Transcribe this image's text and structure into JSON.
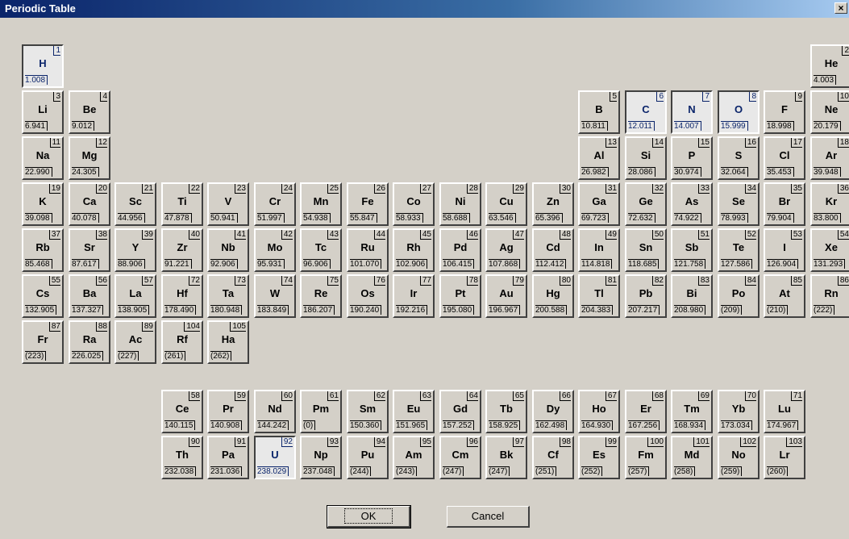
{
  "window": {
    "title": "Periodic Table",
    "close_label": "×"
  },
  "selected_color": "#0a246a",
  "elements": [
    {
      "n": "1",
      "s": "H",
      "m": "1.008",
      "c": 0,
      "r": 0,
      "sel": true
    },
    {
      "n": "2",
      "s": "He",
      "m": "4.003",
      "c": 17,
      "r": 0
    },
    {
      "n": "3",
      "s": "Li",
      "m": "6.941",
      "c": 0,
      "r": 1
    },
    {
      "n": "4",
      "s": "Be",
      "m": "9.012",
      "c": 1,
      "r": 1
    },
    {
      "n": "5",
      "s": "B",
      "m": "10.811",
      "c": 12,
      "r": 1
    },
    {
      "n": "6",
      "s": "C",
      "m": "12.011",
      "c": 13,
      "r": 1,
      "sel": true
    },
    {
      "n": "7",
      "s": "N",
      "m": "14.007",
      "c": 14,
      "r": 1,
      "sel": true
    },
    {
      "n": "8",
      "s": "O",
      "m": "15.999",
      "c": 15,
      "r": 1,
      "sel": true
    },
    {
      "n": "9",
      "s": "F",
      "m": "18.998",
      "c": 16,
      "r": 1
    },
    {
      "n": "10",
      "s": "Ne",
      "m": "20.179",
      "c": 17,
      "r": 1
    },
    {
      "n": "11",
      "s": "Na",
      "m": "22.990",
      "c": 0,
      "r": 2
    },
    {
      "n": "12",
      "s": "Mg",
      "m": "24.305",
      "c": 1,
      "r": 2
    },
    {
      "n": "13",
      "s": "Al",
      "m": "26.982",
      "c": 12,
      "r": 2
    },
    {
      "n": "14",
      "s": "Si",
      "m": "28.086",
      "c": 13,
      "r": 2
    },
    {
      "n": "15",
      "s": "P",
      "m": "30.974",
      "c": 14,
      "r": 2
    },
    {
      "n": "16",
      "s": "S",
      "m": "32.064",
      "c": 15,
      "r": 2
    },
    {
      "n": "17",
      "s": "Cl",
      "m": "35.453",
      "c": 16,
      "r": 2
    },
    {
      "n": "18",
      "s": "Ar",
      "m": "39.948",
      "c": 17,
      "r": 2
    },
    {
      "n": "19",
      "s": "K",
      "m": "39.098",
      "c": 0,
      "r": 3
    },
    {
      "n": "20",
      "s": "Ca",
      "m": "40.078",
      "c": 1,
      "r": 3
    },
    {
      "n": "21",
      "s": "Sc",
      "m": "44.956",
      "c": 2,
      "r": 3
    },
    {
      "n": "22",
      "s": "Ti",
      "m": "47.878",
      "c": 3,
      "r": 3
    },
    {
      "n": "23",
      "s": "V",
      "m": "50.941",
      "c": 4,
      "r": 3
    },
    {
      "n": "24",
      "s": "Cr",
      "m": "51.997",
      "c": 5,
      "r": 3
    },
    {
      "n": "25",
      "s": "Mn",
      "m": "54.938",
      "c": 6,
      "r": 3
    },
    {
      "n": "26",
      "s": "Fe",
      "m": "55.847",
      "c": 7,
      "r": 3
    },
    {
      "n": "27",
      "s": "Co",
      "m": "58.933",
      "c": 8,
      "r": 3
    },
    {
      "n": "28",
      "s": "Ni",
      "m": "58.688",
      "c": 9,
      "r": 3
    },
    {
      "n": "29",
      "s": "Cu",
      "m": "63.546",
      "c": 10,
      "r": 3
    },
    {
      "n": "30",
      "s": "Zn",
      "m": "65.396",
      "c": 11,
      "r": 3
    },
    {
      "n": "31",
      "s": "Ga",
      "m": "69.723",
      "c": 12,
      "r": 3
    },
    {
      "n": "32",
      "s": "Ge",
      "m": "72.632",
      "c": 13,
      "r": 3
    },
    {
      "n": "33",
      "s": "As",
      "m": "74.922",
      "c": 14,
      "r": 3
    },
    {
      "n": "34",
      "s": "Se",
      "m": "78.993",
      "c": 15,
      "r": 3
    },
    {
      "n": "35",
      "s": "Br",
      "m": "79.904",
      "c": 16,
      "r": 3
    },
    {
      "n": "36",
      "s": "Kr",
      "m": "83.800",
      "c": 17,
      "r": 3
    },
    {
      "n": "37",
      "s": "Rb",
      "m": "85.468",
      "c": 0,
      "r": 4
    },
    {
      "n": "38",
      "s": "Sr",
      "m": "87.617",
      "c": 1,
      "r": 4
    },
    {
      "n": "39",
      "s": "Y",
      "m": "88.906",
      "c": 2,
      "r": 4
    },
    {
      "n": "40",
      "s": "Zr",
      "m": "91.221",
      "c": 3,
      "r": 4
    },
    {
      "n": "41",
      "s": "Nb",
      "m": "92.906",
      "c": 4,
      "r": 4
    },
    {
      "n": "42",
      "s": "Mo",
      "m": "95.931",
      "c": 5,
      "r": 4
    },
    {
      "n": "43",
      "s": "Tc",
      "m": "96.906",
      "c": 6,
      "r": 4
    },
    {
      "n": "44",
      "s": "Ru",
      "m": "101.070",
      "c": 7,
      "r": 4
    },
    {
      "n": "45",
      "s": "Rh",
      "m": "102.906",
      "c": 8,
      "r": 4
    },
    {
      "n": "46",
      "s": "Pd",
      "m": "106.415",
      "c": 9,
      "r": 4
    },
    {
      "n": "47",
      "s": "Ag",
      "m": "107.868",
      "c": 10,
      "r": 4
    },
    {
      "n": "48",
      "s": "Cd",
      "m": "112.412",
      "c": 11,
      "r": 4
    },
    {
      "n": "49",
      "s": "In",
      "m": "114.818",
      "c": 12,
      "r": 4
    },
    {
      "n": "50",
      "s": "Sn",
      "m": "118.685",
      "c": 13,
      "r": 4
    },
    {
      "n": "51",
      "s": "Sb",
      "m": "121.758",
      "c": 14,
      "r": 4
    },
    {
      "n": "52",
      "s": "Te",
      "m": "127.586",
      "c": 15,
      "r": 4
    },
    {
      "n": "53",
      "s": "I",
      "m": "126.904",
      "c": 16,
      "r": 4
    },
    {
      "n": "54",
      "s": "Xe",
      "m": "131.293",
      "c": 17,
      "r": 4
    },
    {
      "n": "55",
      "s": "Cs",
      "m": "132.905",
      "c": 0,
      "r": 5
    },
    {
      "n": "56",
      "s": "Ba",
      "m": "137.327",
      "c": 1,
      "r": 5
    },
    {
      "n": "57",
      "s": "La",
      "m": "138.905",
      "c": 2,
      "r": 5
    },
    {
      "n": "72",
      "s": "Hf",
      "m": "178.490",
      "c": 3,
      "r": 5
    },
    {
      "n": "73",
      "s": "Ta",
      "m": "180.948",
      "c": 4,
      "r": 5
    },
    {
      "n": "74",
      "s": "W",
      "m": "183.849",
      "c": 5,
      "r": 5
    },
    {
      "n": "75",
      "s": "Re",
      "m": "186.207",
      "c": 6,
      "r": 5
    },
    {
      "n": "76",
      "s": "Os",
      "m": "190.240",
      "c": 7,
      "r": 5
    },
    {
      "n": "77",
      "s": "Ir",
      "m": "192.216",
      "c": 8,
      "r": 5
    },
    {
      "n": "78",
      "s": "Pt",
      "m": "195.080",
      "c": 9,
      "r": 5
    },
    {
      "n": "79",
      "s": "Au",
      "m": "196.967",
      "c": 10,
      "r": 5
    },
    {
      "n": "80",
      "s": "Hg",
      "m": "200.588",
      "c": 11,
      "r": 5
    },
    {
      "n": "81",
      "s": "Tl",
      "m": "204.383",
      "c": 12,
      "r": 5
    },
    {
      "n": "82",
      "s": "Pb",
      "m": "207.217",
      "c": 13,
      "r": 5
    },
    {
      "n": "83",
      "s": "Bi",
      "m": "208.980",
      "c": 14,
      "r": 5
    },
    {
      "n": "84",
      "s": "Po",
      "m": "(209)",
      "c": 15,
      "r": 5
    },
    {
      "n": "85",
      "s": "At",
      "m": "(210)",
      "c": 16,
      "r": 5
    },
    {
      "n": "86",
      "s": "Rn",
      "m": "(222)",
      "c": 17,
      "r": 5
    },
    {
      "n": "87",
      "s": "Fr",
      "m": "(223)",
      "c": 0,
      "r": 6
    },
    {
      "n": "88",
      "s": "Ra",
      "m": "226.025",
      "c": 1,
      "r": 6
    },
    {
      "n": "89",
      "s": "Ac",
      "m": "(227)",
      "c": 2,
      "r": 6
    },
    {
      "n": "104",
      "s": "Rf",
      "m": "(261)",
      "c": 3,
      "r": 6
    },
    {
      "n": "105",
      "s": "Ha",
      "m": "(262)",
      "c": 4,
      "r": 6
    },
    {
      "n": "58",
      "s": "Ce",
      "m": "140.115",
      "c": 3,
      "r": 7.5
    },
    {
      "n": "59",
      "s": "Pr",
      "m": "140.908",
      "c": 4,
      "r": 7.5
    },
    {
      "n": "60",
      "s": "Nd",
      "m": "144.242",
      "c": 5,
      "r": 7.5
    },
    {
      "n": "61",
      "s": "Pm",
      "m": "(0)",
      "c": 6,
      "r": 7.5
    },
    {
      "n": "62",
      "s": "Sm",
      "m": "150.360",
      "c": 7,
      "r": 7.5
    },
    {
      "n": "63",
      "s": "Eu",
      "m": "151.965",
      "c": 8,
      "r": 7.5
    },
    {
      "n": "64",
      "s": "Gd",
      "m": "157.252",
      "c": 9,
      "r": 7.5
    },
    {
      "n": "65",
      "s": "Tb",
      "m": "158.925",
      "c": 10,
      "r": 7.5
    },
    {
      "n": "66",
      "s": "Dy",
      "m": "162.498",
      "c": 11,
      "r": 7.5
    },
    {
      "n": "67",
      "s": "Ho",
      "m": "164.930",
      "c": 12,
      "r": 7.5
    },
    {
      "n": "68",
      "s": "Er",
      "m": "167.256",
      "c": 13,
      "r": 7.5
    },
    {
      "n": "69",
      "s": "Tm",
      "m": "168.934",
      "c": 14,
      "r": 7.5
    },
    {
      "n": "70",
      "s": "Yb",
      "m": "173.034",
      "c": 15,
      "r": 7.5
    },
    {
      "n": "71",
      "s": "Lu",
      "m": "174.967",
      "c": 16,
      "r": 7.5
    },
    {
      "n": "90",
      "s": "Th",
      "m": "232.038",
      "c": 3,
      "r": 8.5
    },
    {
      "n": "91",
      "s": "Pa",
      "m": "231.036",
      "c": 4,
      "r": 8.5
    },
    {
      "n": "92",
      "s": "U",
      "m": "238.029",
      "c": 5,
      "r": 8.5,
      "sel": true
    },
    {
      "n": "93",
      "s": "Np",
      "m": "237.048",
      "c": 6,
      "r": 8.5
    },
    {
      "n": "94",
      "s": "Pu",
      "m": "(244)",
      "c": 7,
      "r": 8.5
    },
    {
      "n": "95",
      "s": "Am",
      "m": "(243)",
      "c": 8,
      "r": 8.5
    },
    {
      "n": "96",
      "s": "Cm",
      "m": "(247)",
      "c": 9,
      "r": 8.5
    },
    {
      "n": "97",
      "s": "Bk",
      "m": "(247)",
      "c": 10,
      "r": 8.5
    },
    {
      "n": "98",
      "s": "Cf",
      "m": "(251)",
      "c": 11,
      "r": 8.5
    },
    {
      "n": "99",
      "s": "Es",
      "m": "(252)",
      "c": 12,
      "r": 8.5
    },
    {
      "n": "100",
      "s": "Fm",
      "m": "(257)",
      "c": 13,
      "r": 8.5
    },
    {
      "n": "101",
      "s": "Md",
      "m": "(258)",
      "c": 14,
      "r": 8.5
    },
    {
      "n": "102",
      "s": "No",
      "m": "(259)",
      "c": 15,
      "r": 8.5
    },
    {
      "n": "103",
      "s": "Lr",
      "m": "(260)",
      "c": 16,
      "r": 8.5
    }
  ],
  "buttons": {
    "ok_label": "OK",
    "cancel_label": "Cancel"
  }
}
